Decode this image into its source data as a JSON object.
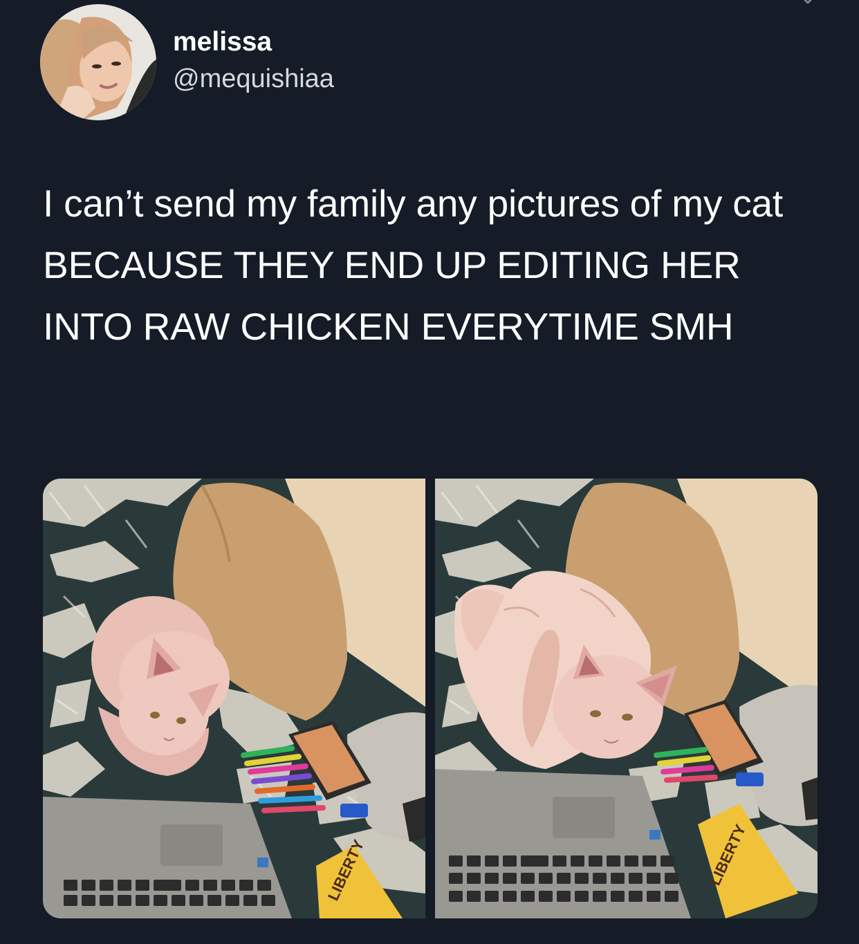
{
  "tweet": {
    "display_name": "melissa",
    "handle": "@mequishiaa",
    "text": "I can’t send my family any pictures of my cat BECAUSE THEY END UP EDITING HER INTO RAW CHICKEN EVERYTIME SMH"
  },
  "media": {
    "photo_left": {
      "label": "LIBERTY"
    },
    "photo_right": {
      "label": "LIBERTY"
    }
  },
  "icons": {
    "menu": "chevron-down-icon"
  }
}
